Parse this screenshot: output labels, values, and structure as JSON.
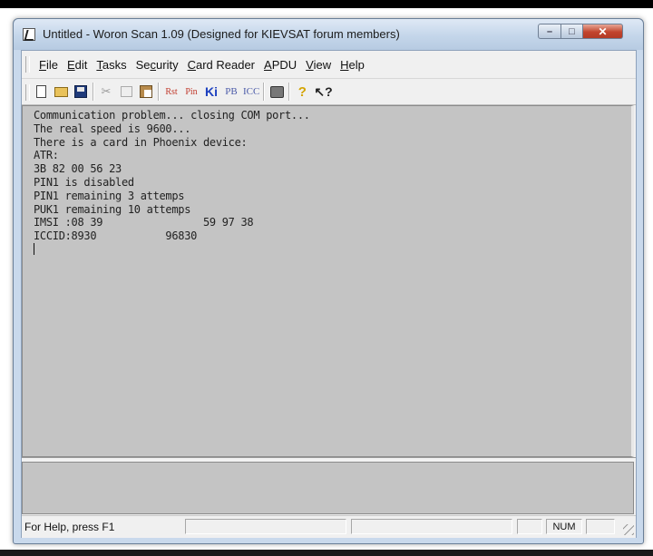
{
  "window": {
    "title": "Untitled - Woron Scan 1.09 (Designed for KIEVSAT forum members)",
    "icons": {
      "app": "app-icon",
      "minimize": "minimize-icon",
      "maximize": "maximize-icon",
      "close": "close-icon"
    }
  },
  "menubar": {
    "items": [
      {
        "pre": "",
        "u": "F",
        "post": "ile"
      },
      {
        "pre": "",
        "u": "E",
        "post": "dit"
      },
      {
        "pre": "",
        "u": "T",
        "post": "asks"
      },
      {
        "pre": "Se",
        "u": "c",
        "post": "urity"
      },
      {
        "pre": "",
        "u": "C",
        "post": "ard Reader"
      },
      {
        "pre": "",
        "u": "A",
        "post": "PDU"
      },
      {
        "pre": "",
        "u": "V",
        "post": "iew"
      },
      {
        "pre": "",
        "u": "H",
        "post": "elp"
      }
    ]
  },
  "toolbar": {
    "rst_label": "Rst",
    "pin_label": "Pin",
    "ki_label": "Ki",
    "pb_label": "PB",
    "icc_label": "ICC",
    "icons": [
      "new-file-icon",
      "open-folder-icon",
      "save-icon",
      "cut-icon",
      "copy-icon",
      "paste-icon",
      "print-icon",
      "about-icon",
      "context-help-icon"
    ]
  },
  "terminal": {
    "lines": [
      "Communication problem... closing COM port...",
      "The real speed is 9600...",
      "There is a card in Phoenix device:",
      "ATR:",
      "3B 82 00 56 23",
      "PIN1 is disabled",
      "PIN1 remaining 3 attemps",
      "PUK1 remaining 10 attemps",
      "IMSI :08 39                59 97 38",
      "ICCID:8930           96830"
    ]
  },
  "statusbar": {
    "help_text": "For Help, press F1",
    "num_indicator": "NUM"
  },
  "colors": {
    "terminal_bg": "#c4c4c4",
    "close_button": "#c2452e",
    "titlebar": "#c4d6ea"
  }
}
